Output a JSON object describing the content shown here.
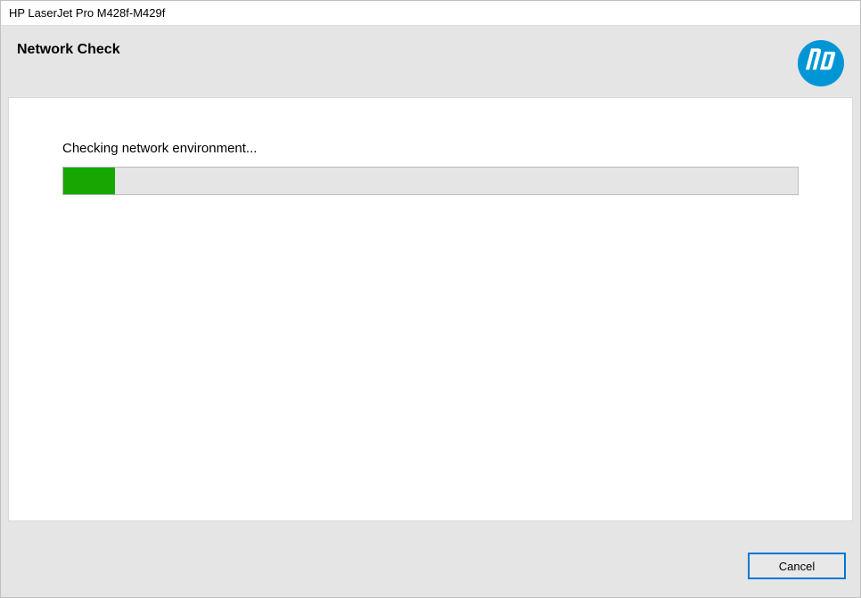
{
  "window": {
    "title": "HP LaserJet Pro M428f-M429f"
  },
  "header": {
    "title": "Network Check",
    "logo_color": "#0096d6",
    "logo_name": "hp-logo"
  },
  "main": {
    "status_text": "Checking network environment...",
    "progress": {
      "percent": 7,
      "fill_color": "#16a800",
      "track_color": "#e5e5e5"
    }
  },
  "footer": {
    "cancel_label": "Cancel"
  }
}
